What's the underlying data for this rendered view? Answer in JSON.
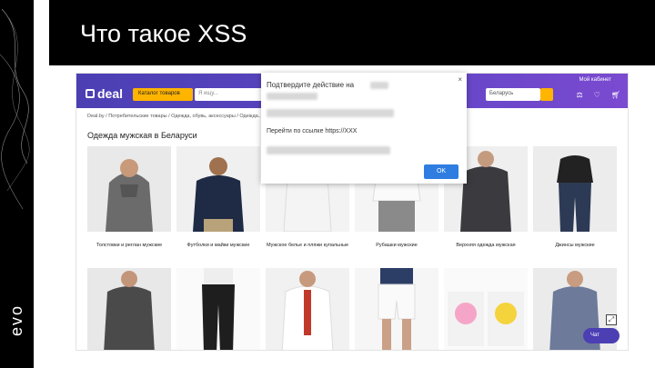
{
  "slide": {
    "title": "Что такое XSS",
    "logo": "evo"
  },
  "site": {
    "brand": "deal",
    "catalog_button": "Каталог товаров",
    "search_placeholder": "Я ищу...",
    "my_cabinet": "Мой кабинет",
    "region": "Беларусь",
    "breadcrumbs": "Deal.by / Потребительские товары / Одежда, обувь, аксессуары / Одежда...",
    "heading": "Одежда мужская в Беларуси",
    "categories": [
      {
        "label": "Толстовки и реглан мужские"
      },
      {
        "label": "Футболки и майки мужские"
      },
      {
        "label": "Мужское белье и пляжи купальные"
      },
      {
        "label": "Рубашки мужские"
      },
      {
        "label": "Верхняя одежда мужская"
      },
      {
        "label": "Джинсы мужские"
      },
      {
        "label": ""
      },
      {
        "label": ""
      },
      {
        "label": ""
      },
      {
        "label": ""
      },
      {
        "label": ""
      },
      {
        "label": ""
      }
    ],
    "chat_label": "Чат"
  },
  "dialog": {
    "title": "Подтвердите действие на",
    "message": "Перейти по ссылке https://XXX",
    "ok": "OK",
    "close": "×"
  },
  "colors": {
    "header_purple": "#5b45c2",
    "accent_yellow": "#ffb400",
    "ok_blue": "#2f7de1"
  }
}
